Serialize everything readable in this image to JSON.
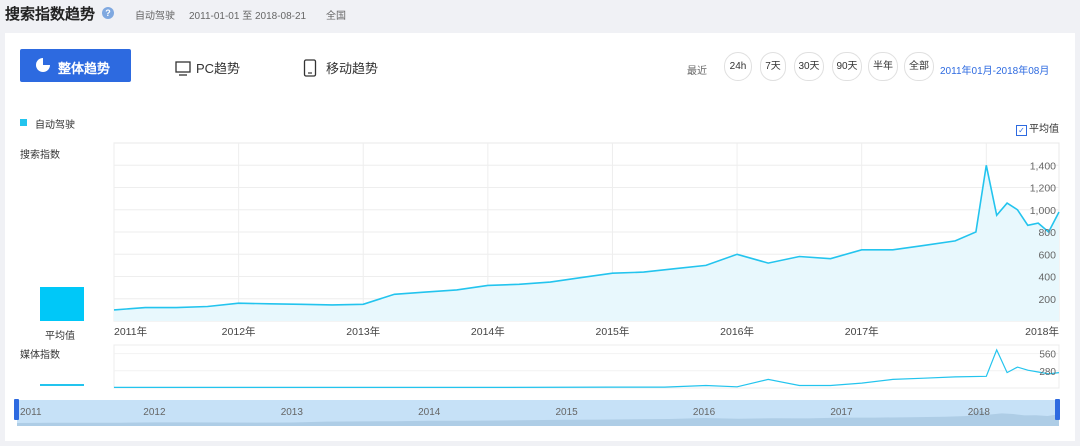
{
  "header": {
    "title": "搜索指数趋势",
    "keyword": "自动驾驶",
    "date_range": "2011-01-01 至 2018-08-21",
    "region": "全国"
  },
  "tabs": [
    {
      "label": "整体趋势",
      "active": true
    },
    {
      "label": "PC趋势",
      "active": false
    },
    {
      "label": "移动趋势",
      "active": false
    }
  ],
  "range": {
    "label": "最近",
    "buttons": [
      "24h",
      "7天",
      "30天",
      "90天",
      "半年",
      "全部"
    ],
    "selected_period": "2011年01月-2018年08月"
  },
  "legend": {
    "series_name": "自动驾驶",
    "color": "#23c4ee"
  },
  "avg_toggle": {
    "label": "平均值",
    "checked": true
  },
  "avg_label": "平均值",
  "chart_data": [
    {
      "type": "area",
      "title": "搜索指数",
      "series": [
        {
          "name": "自动驾驶",
          "x": [
            "2011-01",
            "2011-04",
            "2011-07",
            "2011-10",
            "2012-01",
            "2012-04",
            "2012-07",
            "2012-10",
            "2013-01",
            "2013-04",
            "2013-07",
            "2013-10",
            "2014-01",
            "2014-04",
            "2014-07",
            "2014-10",
            "2015-01",
            "2015-04",
            "2015-07",
            "2015-10",
            "2016-01",
            "2016-04",
            "2016-07",
            "2016-10",
            "2017-01",
            "2017-04",
            "2017-07",
            "2017-10",
            "2017-12",
            "2018-01",
            "2018-02",
            "2018-03",
            "2018-04",
            "2018-05",
            "2018-06",
            "2018-07",
            "2018-08"
          ],
          "values": [
            100,
            120,
            120,
            130,
            160,
            155,
            150,
            145,
            150,
            240,
            260,
            280,
            320,
            330,
            350,
            390,
            430,
            440,
            470,
            500,
            600,
            520,
            580,
            560,
            640,
            640,
            680,
            720,
            800,
            1400,
            950,
            1060,
            1000,
            860,
            880,
            800,
            980
          ]
        }
      ],
      "x_tick_labels": [
        "2011年",
        "2012年",
        "2013年",
        "2014年",
        "2015年",
        "2016年",
        "2017年",
        "2018年"
      ],
      "y_ticks": [
        200,
        400,
        600,
        800,
        1000,
        1200,
        1400
      ],
      "ylim": [
        0,
        1600
      ],
      "average": 200,
      "grid": true
    },
    {
      "type": "line",
      "title": "媒体指数",
      "series": [
        {
          "name": "自动驾驶",
          "x": [
            "2011-01",
            "2012-01",
            "2013-01",
            "2014-01",
            "2015-01",
            "2015-06",
            "2015-10",
            "2016-01",
            "2016-04",
            "2016-07",
            "2016-10",
            "2017-01",
            "2017-04",
            "2017-07",
            "2017-10",
            "2018-01",
            "2018-02",
            "2018-03",
            "2018-04",
            "2018-05",
            "2018-06",
            "2018-07",
            "2018-08"
          ],
          "values": [
            10,
            10,
            10,
            10,
            15,
            15,
            40,
            20,
            140,
            40,
            40,
            80,
            140,
            160,
            180,
            190,
            620,
            250,
            340,
            290,
            260,
            230,
            250
          ]
        }
      ],
      "y_ticks": [
        280,
        560
      ],
      "ylim": [
        0,
        700
      ],
      "average": 12
    }
  ],
  "navigator": {
    "year_labels": [
      "2011",
      "2012",
      "2013",
      "2014",
      "2015",
      "2016",
      "2017",
      "2018"
    ]
  }
}
